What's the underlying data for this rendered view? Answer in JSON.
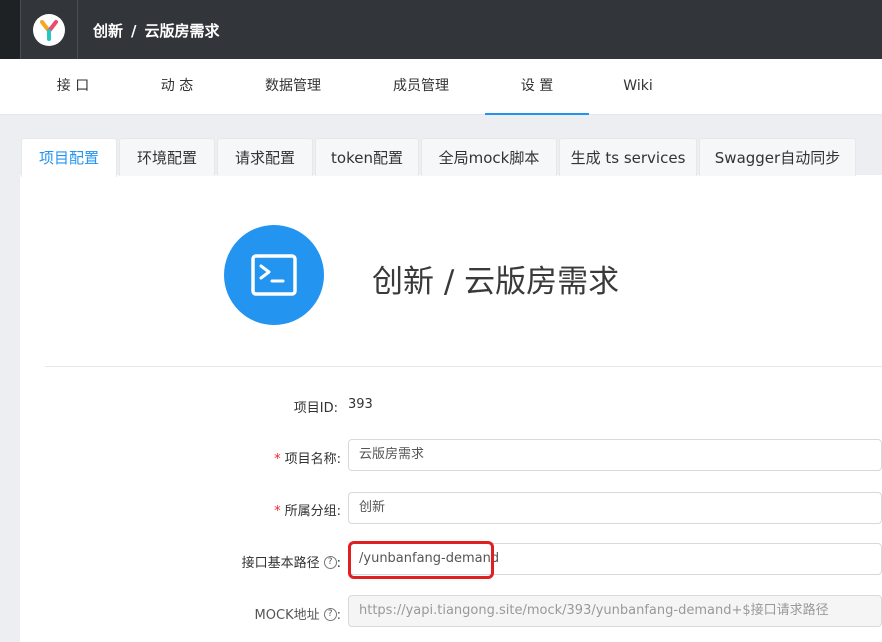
{
  "header": {
    "breadcrumb": {
      "group": "创新",
      "separator": "/",
      "project": "云版房需求"
    }
  },
  "topnav": {
    "items": [
      {
        "label": "接 口"
      },
      {
        "label": "动 态"
      },
      {
        "label": "数据管理"
      },
      {
        "label": "成员管理"
      },
      {
        "label": "设 置",
        "active": true
      },
      {
        "label": "Wiki"
      }
    ]
  },
  "subtabs": [
    {
      "label": "项目配置",
      "active": true
    },
    {
      "label": "环境配置"
    },
    {
      "label": "请求配置"
    },
    {
      "label": "token配置"
    },
    {
      "label": "全局mock脚本"
    },
    {
      "label": "生成 ts services"
    },
    {
      "label": "Swagger自动同步"
    }
  ],
  "project": {
    "title": "创新 / 云版房需求"
  },
  "form": {
    "project_id": {
      "label": "项目ID",
      "colon": ":",
      "value": "393"
    },
    "project_name": {
      "required_mark": "*",
      "label": "项目名称",
      "colon": ":",
      "value": "云版房需求"
    },
    "group": {
      "required_mark": "*",
      "label": "所属分组",
      "colon": ":",
      "value": "创新"
    },
    "base_path": {
      "label": "接口基本路径",
      "help": "?",
      "colon": ":",
      "value": "/yunbanfang-demand"
    },
    "mock_url": {
      "label": "MOCK地址",
      "help": "?",
      "colon": ":",
      "value": "https://yapi.tiangong.site/mock/393/yunbanfang-demand+$接口请求路径"
    }
  },
  "colors": {
    "accent": "#2395f1",
    "header_bg": "#32363a",
    "highlight": "#e02020"
  },
  "icons": {
    "logo": "yapi-logo-icon",
    "project": "terminal-icon"
  }
}
